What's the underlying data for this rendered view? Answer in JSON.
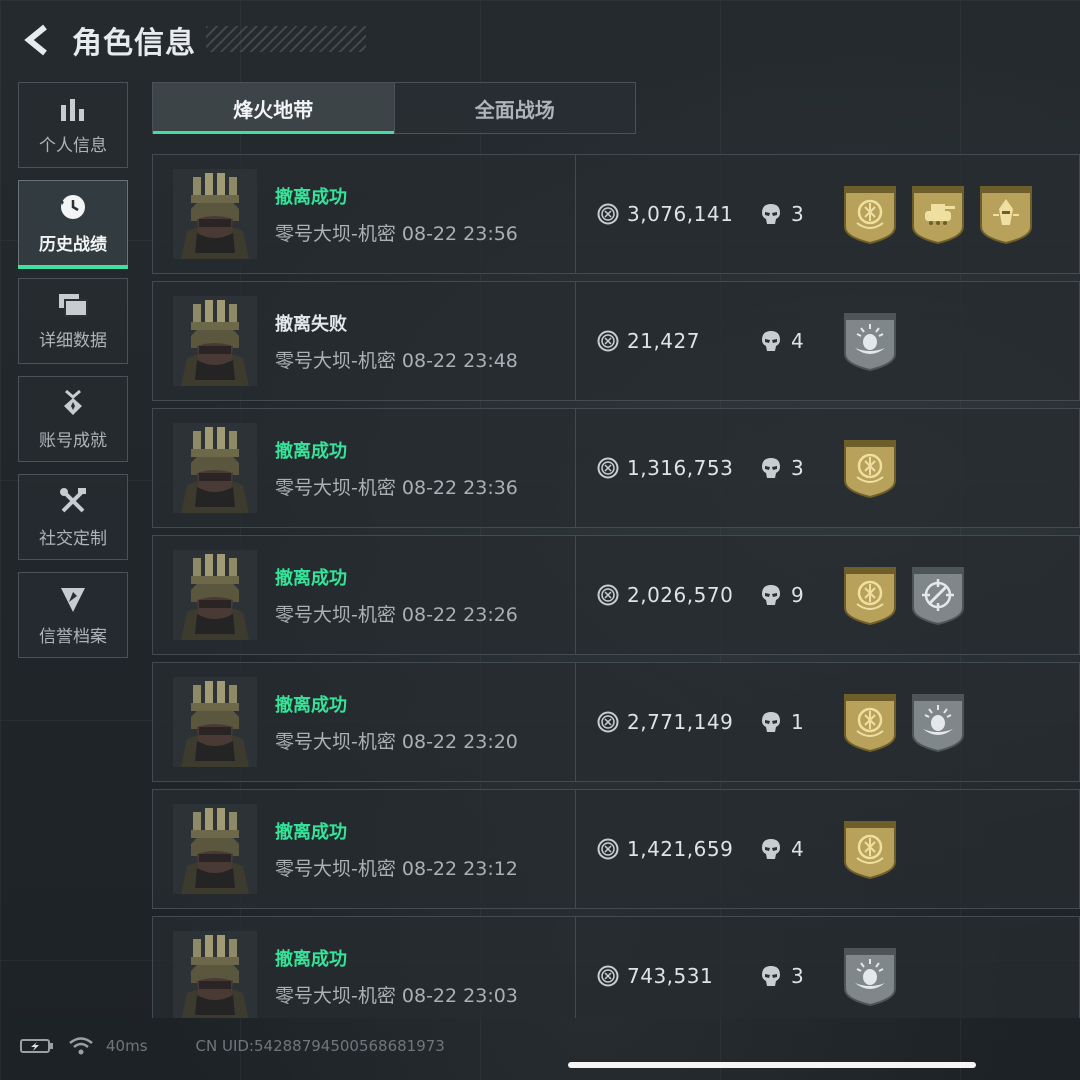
{
  "header": {
    "title": "角色信息"
  },
  "sidebar": {
    "items": [
      {
        "label": "个人信息",
        "icon": "bar-chart-icon",
        "active": false
      },
      {
        "label": "历史战绩",
        "icon": "clock-history-icon",
        "active": true
      },
      {
        "label": "详细数据",
        "icon": "folder-icon",
        "active": false
      },
      {
        "label": "账号成就",
        "icon": "achievement-medal-icon",
        "active": false
      },
      {
        "label": "社交定制",
        "icon": "tools-icon",
        "active": false
      },
      {
        "label": "信誉档案",
        "icon": "shield-icon",
        "active": false
      }
    ]
  },
  "tabs": [
    {
      "label": "烽火地带",
      "active": true
    },
    {
      "label": "全面战场",
      "active": false
    }
  ],
  "colors": {
    "accent": "#3fe0a2",
    "success": "#37e398",
    "gold_badge": "#b8a15a",
    "grey_badge": "#8a9296"
  },
  "matches": [
    {
      "status": "撤离成功",
      "result": "success",
      "detail": "零号大坝-机密 08-22 23:56",
      "money": "3,076,141",
      "kills": "3",
      "badges": [
        "gold-emblem-badge",
        "gold-tank-badge",
        "gold-operator-badge"
      ]
    },
    {
      "status": "撤离失败",
      "result": "fail",
      "detail": "零号大坝-机密 08-22 23:48",
      "money": "21,427",
      "kills": "4",
      "badges": [
        "grey-egg-badge"
      ]
    },
    {
      "status": "撤离成功",
      "result": "success",
      "detail": "零号大坝-机密 08-22 23:36",
      "money": "1,316,753",
      "kills": "3",
      "badges": [
        "gold-emblem-badge"
      ]
    },
    {
      "status": "撤离成功",
      "result": "success",
      "detail": "零号大坝-机密 08-22 23:26",
      "money": "2,026,570",
      "kills": "9",
      "badges": [
        "gold-emblem-badge",
        "grey-crosshair-badge"
      ]
    },
    {
      "status": "撤离成功",
      "result": "success",
      "detail": "零号大坝-机密 08-22 23:20",
      "money": "2,771,149",
      "kills": "1",
      "badges": [
        "gold-emblem-badge",
        "grey-egg-badge"
      ]
    },
    {
      "status": "撤离成功",
      "result": "success",
      "detail": "零号大坝-机密 08-22 23:12",
      "money": "1,421,659",
      "kills": "4",
      "badges": [
        "gold-emblem-badge"
      ]
    },
    {
      "status": "撤离成功",
      "result": "success",
      "detail": "零号大坝-机密 08-22 23:03",
      "money": "743,531",
      "kills": "3",
      "badges": [
        "grey-egg-badge"
      ]
    }
  ],
  "footer": {
    "ping": "40ms",
    "uid": "CN UID:5428879450056868197​3"
  }
}
